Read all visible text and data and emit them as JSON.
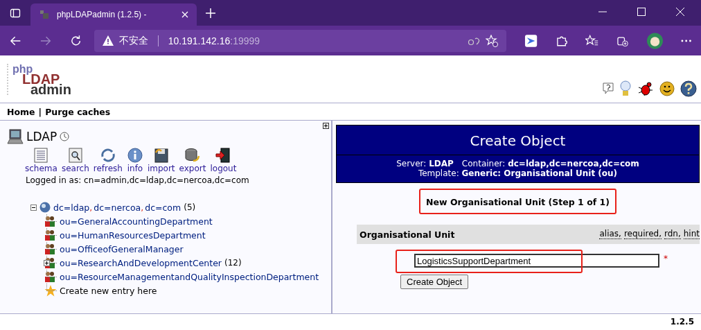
{
  "browser": {
    "tab_title": "phpLDAPadmin (1.2.5) -",
    "security": "不安全",
    "url_host": "10.191.142.16",
    "url_port": ":19999"
  },
  "logo": {
    "line1": "php",
    "line2": "LDAP",
    "line3": "admin"
  },
  "nav": {
    "links": [
      "Home",
      "Purge caches"
    ],
    "separator": "|"
  },
  "server": {
    "name": "LDAP",
    "actions": [
      "schema",
      "search",
      "refresh",
      "info",
      "import",
      "export",
      "logout"
    ],
    "logged_in": "Logged in as: cn=admin,dc=ldap,dc=nercoa,dc=com"
  },
  "tree": {
    "root": {
      "parts": [
        "dc=ldap",
        "dc=nercoa",
        "dc=com"
      ],
      "separator": ",",
      "count": "(5)",
      "expanded": true
    },
    "children": [
      {
        "kind": "ou",
        "label": "ou=GeneralAccountingDepartment"
      },
      {
        "kind": "ou",
        "label": "ou=HumanResourcesDepartment"
      },
      {
        "kind": "ou",
        "label": "ou=OfficeofGeneralManager"
      },
      {
        "kind": "ou",
        "label": "ou=ResearchAndDevelopmentCenter",
        "count": "(12)",
        "expanded": false
      },
      {
        "kind": "ou",
        "label": "ou=ResourceManagementandQualityInspectionDepartment"
      },
      {
        "kind": "create",
        "label": "Create new entry here"
      }
    ]
  },
  "panel": {
    "title": "Create Object",
    "info": [
      "Server: **LDAP**",
      "Container: **dc=ldap,dc=nercoa,dc=com**"
    ],
    "template": "Template: **Generic: Organisational Unit (ou)**"
  },
  "form": {
    "step": "New Organisational Unit (Step 1 of 1)",
    "step_highlighted": true,
    "attribute": "Organisational Unit",
    "hints": [
      "alias,",
      "required,",
      "rdn,",
      "hint"
    ],
    "value": "LogisticsSupportDepartment",
    "value_highlighted": true,
    "required_mark": "*",
    "submit": "Create Object"
  },
  "version": "1.2.5"
}
